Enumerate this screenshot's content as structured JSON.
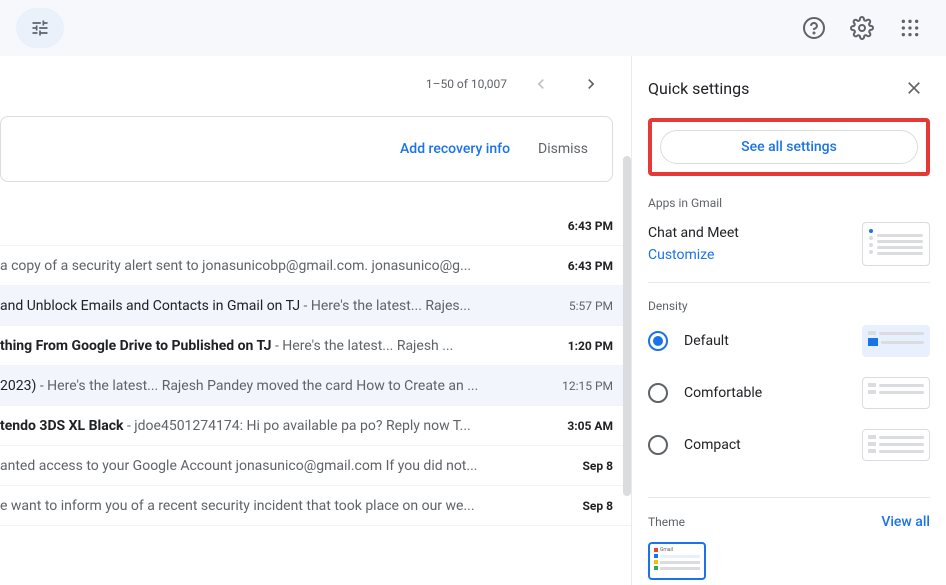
{
  "topbar": {
    "help_label": "Help",
    "settings_label": "Settings",
    "apps_label": "Google apps"
  },
  "pagination": {
    "range": "1–50 of 10,007"
  },
  "recovery": {
    "add_label": "Add recovery info",
    "dismiss_label": "Dismiss"
  },
  "emails": [
    {
      "subject": "",
      "snippet": "",
      "time": "6:43 PM",
      "unread": true
    },
    {
      "subject": "",
      "snippet": "a copy of a security alert sent to jonasunicobp@gmail.com. jonasunico@g...",
      "time": "6:43 PM",
      "unread": true
    },
    {
      "subject": " and Unblock Emails and Contacts in Gmail on TJ",
      "snippet": " - Here's the latest... Rajes...",
      "time": "5:57 PM",
      "unread": false
    },
    {
      "subject": "thing From Google Drive to Published on TJ",
      "snippet": " - Here's the latest... Rajesh ...",
      "time": "1:20 PM",
      "unread": true
    },
    {
      "subject": "2023)",
      "snippet": " - Here's the latest... Rajesh Pandey moved the card How to Create an ...",
      "time": "12:15 PM",
      "unread": false
    },
    {
      "subject": "tendo 3DS XL Black",
      "snippet": " - jdoe4501274174: Hi po available pa po? Reply now T...",
      "time": "3:05 AM",
      "unread": true
    },
    {
      "subject": "",
      "snippet": "anted access to your Google Account jonasunico@gmail.com If you did not...",
      "time": "Sep 8",
      "unread": true
    },
    {
      "subject": "",
      "snippet": "e want to inform you of a recent security incident that took place on our we...",
      "time": "Sep 8",
      "unread": true
    }
  ],
  "settings": {
    "title": "Quick settings",
    "see_all": "See all settings",
    "apps_section": "Apps in Gmail",
    "chat_meet": "Chat and Meet",
    "customize": "Customize",
    "density_section": "Density",
    "density_options": {
      "default": "Default",
      "comfortable": "Comfortable",
      "compact": "Compact"
    },
    "theme_section": "Theme",
    "view_all": "View all"
  }
}
